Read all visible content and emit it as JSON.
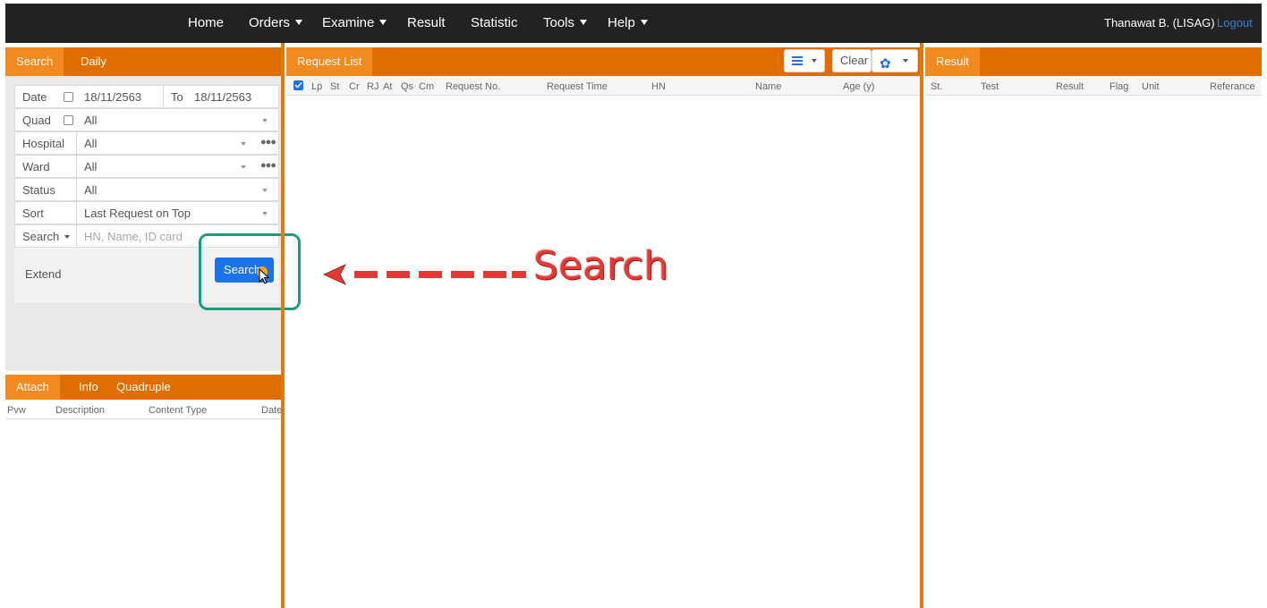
{
  "nav": {
    "items": [
      {
        "label": "Home",
        "dropdown": false
      },
      {
        "label": "Orders",
        "dropdown": true
      },
      {
        "label": "Examine",
        "dropdown": true
      },
      {
        "label": "Result",
        "dropdown": false
      },
      {
        "label": "Statistic",
        "dropdown": false
      },
      {
        "label": "Tools",
        "dropdown": true
      },
      {
        "label": "Help",
        "dropdown": true
      }
    ],
    "user": "Thanawat B. (LISAG)",
    "logout": "Logout"
  },
  "left": {
    "tabs": [
      "Search",
      "Daily"
    ],
    "active_tab": "Search",
    "form": {
      "date_label": "Date",
      "date_from": "18/11/2563",
      "to_label": "To",
      "date_to": "18/11/2563",
      "quad_label": "Quad",
      "quad_value": "All",
      "hospital_label": "Hospital",
      "hospital_value": "All",
      "ward_label": "Ward",
      "ward_value": "All",
      "status_label": "Status",
      "status_value": "All",
      "sort_label": "Sort",
      "sort_value": "Last Request on Top",
      "search_label": "Search",
      "search_placeholder": "HN, Name, ID card"
    },
    "extend_label": "Extend",
    "search_button": "Search",
    "bottom_tabs": [
      "Attach",
      "Info",
      "Quadruple"
    ],
    "bottom_active_tab": "Attach",
    "attach_columns": [
      "Pvw",
      "Description",
      "Content Type",
      "Date"
    ]
  },
  "request": {
    "tab": "Request List",
    "clear_label": "Clear",
    "columns": [
      "Lp",
      "St",
      "Cr",
      "RJ",
      "At",
      "Qs",
      "Cm",
      "Request No.",
      "Request Time",
      "HN",
      "Name",
      "Age (y)"
    ]
  },
  "result": {
    "tab": "Result",
    "columns": [
      "St.",
      "Test",
      "Result",
      "Flag",
      "Unit",
      "Referance"
    ]
  },
  "annotation": {
    "label": "Search",
    "color": "#e53935"
  },
  "colors": {
    "nav_bg": "#222222",
    "tab_bar": "#e06d00",
    "tab_active": "#f28b1f",
    "button_primary": "#1a73e8",
    "highlight": "#1c9c7e"
  }
}
